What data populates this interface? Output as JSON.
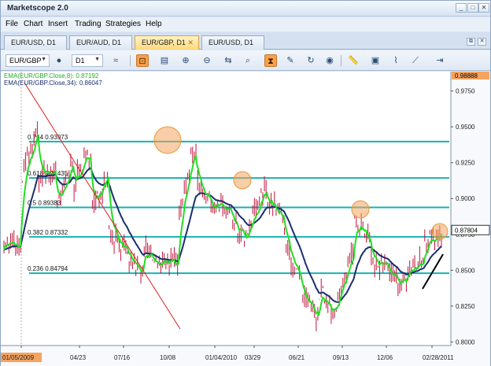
{
  "app": {
    "title": "Marketscope 2.0"
  },
  "window_buttons": {
    "restore": "⧉",
    "minimize": "_",
    "maximize": "□",
    "close": "✕"
  },
  "menu": [
    "File",
    "Chart",
    "Insert",
    "Trading",
    "Strategies",
    "Help"
  ],
  "tabs": [
    {
      "label": "EUR/USD, D1",
      "active": false
    },
    {
      "label": "EUR/AUD, D1",
      "active": false
    },
    {
      "label": "EUR/GBP, D1",
      "active": true
    },
    {
      "label": "EUR/USD, D1",
      "active": false
    }
  ],
  "toolbar": {
    "symbol": "EUR/GBP",
    "timeframe": "D1"
  },
  "colors": {
    "ema_fast": "#22dd22",
    "ema_slow": "#1a2e6e",
    "fib_line": "#17b2b2",
    "trend_line": "#e02020",
    "price_bar": "#c0143c",
    "highlight": "#f4a460"
  },
  "legend": {
    "ema_fast": "EMA(EUR/GBP.Close,8): 0.87192",
    "ema_slow": "EMA(EUR/GBP.Close,34): 0.86047"
  },
  "fib_labels": [
    "0.764 0.93973",
    "0.618 0.91435",
    "0.5 0.89383",
    "0.382 0.87332",
    "0.236 0.84794"
  ],
  "chart_data": {
    "type": "candlestick",
    "price_axis": [
      "0.9750",
      "0.9500",
      "0.9250",
      "0.9000",
      "0.8750",
      "0.8500",
      "0.8250",
      "0.8000"
    ],
    "price_top_label": "0.98888",
    "current_price": "0.87804",
    "date_axis": [
      "01/05/2009",
      "04/23",
      "07/16",
      "10/08",
      "01/04/2010",
      "03/29",
      "06/21",
      "09/13",
      "12/06",
      "02/28/2011"
    ],
    "ylim": [
      0.7975,
      0.9885
    ],
    "fib_levels": [
      0.93973,
      0.91435,
      0.89383,
      0.87332,
      0.84794
    ],
    "close_path": [
      [
        0.87,
        0.865
      ],
      [
        0.915,
        0.95
      ],
      [
        0.915,
        0.92
      ],
      [
        0.89,
        0.93
      ],
      [
        0.91,
        0.935
      ],
      [
        0.89,
        0.92
      ],
      [
        0.88,
        0.86
      ],
      [
        0.86,
        0.845
      ],
      [
        0.865,
        0.85
      ],
      [
        0.86,
        0.85
      ],
      [
        0.895,
        0.94
      ],
      [
        0.91,
        0.895
      ],
      [
        0.895,
        0.89
      ],
      [
        0.88,
        0.87
      ],
      [
        0.88,
        0.91
      ],
      [
        0.9,
        0.885
      ],
      [
        0.87,
        0.84
      ],
      [
        0.83,
        0.815
      ],
      [
        0.835,
        0.82
      ],
      [
        0.825,
        0.87
      ],
      [
        0.89,
        0.865
      ],
      [
        0.855,
        0.85
      ],
      [
        0.845,
        0.84
      ],
      [
        0.85,
        0.855
      ],
      [
        0.87,
        0.878
      ]
    ]
  }
}
